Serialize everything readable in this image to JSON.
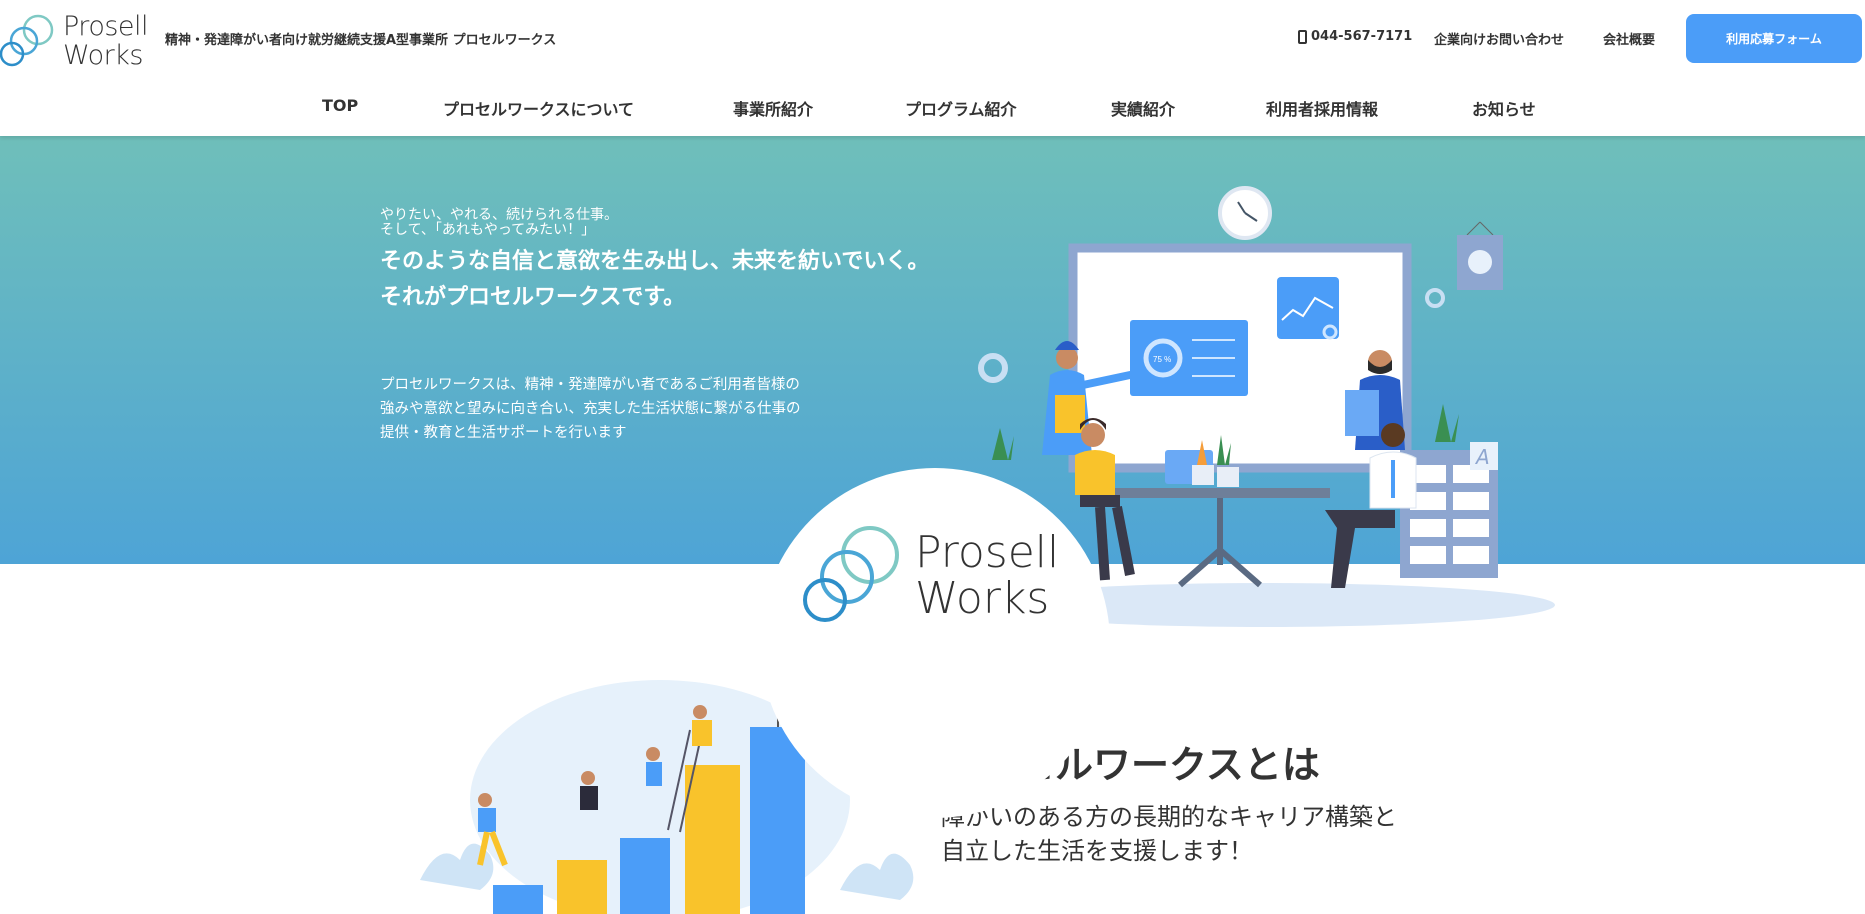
{
  "header": {
    "logo": {
      "line1": "Prosell",
      "line2": "Works"
    },
    "tagline": "精神・発達障がい者向け就労継続支援A型事業所 プロセルワークス",
    "phone": "044-567-7171",
    "corporate_contact": "企業向けお問い合わせ",
    "company_overview": "会社概要",
    "apply_button": "利用応募フォーム"
  },
  "nav": [
    {
      "label": "TOP"
    },
    {
      "label": "プロセルワークスについて"
    },
    {
      "label": "事業所紹介"
    },
    {
      "label": "プログラム紹介"
    },
    {
      "label": "実績紹介"
    },
    {
      "label": "利用者採用情報"
    },
    {
      "label": "お知らせ"
    }
  ],
  "hero": {
    "small_line1": "やりたい、やれる、続けられる仕事。",
    "small_line2": "そして、「あれもやってみたい！」",
    "big_line1": "そのような自信と意欲を生み出し、未来を紡いでいく。",
    "big_line2": "それがプロセルワークスです。",
    "desc_line1": "プロセルワークスは、精神・発達障がい者であるご利用者皆様の",
    "desc_line2": "強みや意欲と望みに向き合い、充実した生活状態に繋がる仕事の",
    "desc_line3": "提供・教育と生活サポートを行います",
    "big_logo": {
      "line1": "Prosell",
      "line2": "Works"
    },
    "chart_percent": "75 %"
  },
  "about": {
    "title": "プロセルワークスとは",
    "sub_line1": "障がいのある方の長期的なキャリア構築と",
    "sub_line2": "自立した生活を支援します！"
  },
  "colors": {
    "accent": "#4b9df8",
    "hero_top": "#6fbfba",
    "hero_bottom": "#4ea4d6",
    "yellow": "#f9c32b"
  }
}
